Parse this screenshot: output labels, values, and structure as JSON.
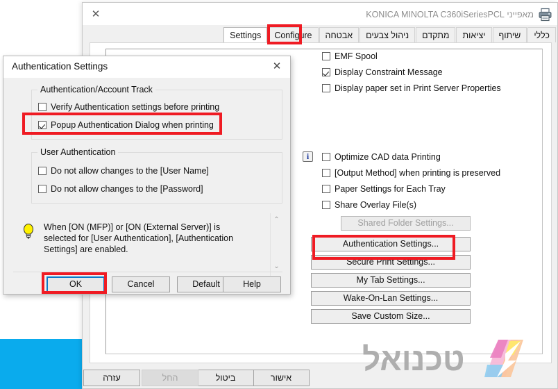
{
  "window": {
    "title": "מאפייני KONICA MINOLTA C360iSeriesPCL",
    "close_label": "✕",
    "printer_icon": "printer-icon",
    "faint_top_text": "מאפיינים"
  },
  "tabs": [
    {
      "label": "כללי",
      "selected": false,
      "ltr": false
    },
    {
      "label": "שיתוף",
      "selected": false,
      "ltr": false
    },
    {
      "label": "יציאות",
      "selected": false,
      "ltr": false
    },
    {
      "label": "מתקדם",
      "selected": false,
      "ltr": false
    },
    {
      "label": "ניהול צבעים",
      "selected": false,
      "ltr": false
    },
    {
      "label": "אבטחה",
      "selected": false,
      "ltr": false
    },
    {
      "label": "Configure",
      "selected": false,
      "ltr": true
    },
    {
      "label": "Settings",
      "selected": true,
      "ltr": true
    }
  ],
  "settings_tab": {
    "checkboxes": [
      {
        "label": "EMF Spool",
        "checked": false
      },
      {
        "label": "Display Constraint Message",
        "checked": true
      },
      {
        "label": "Display paper set in Print Server Properties",
        "checked": false
      },
      {
        "label": "Optimize CAD data Printing",
        "checked": false
      },
      {
        "label": "[Output Method] when printing is preserved",
        "checked": false
      },
      {
        "label": "Paper Settings for Each Tray",
        "checked": false
      },
      {
        "label": "Share Overlay File(s)",
        "checked": false
      }
    ],
    "info_icon": "info-icon",
    "buttons": [
      {
        "label": "Shared Folder Settings...",
        "disabled": true
      },
      {
        "label": "Authentication Settings...",
        "disabled": false
      },
      {
        "label": "Secure Print Settings...",
        "disabled": false
      },
      {
        "label": "My Tab Settings...",
        "disabled": false
      },
      {
        "label": "Wake-On-Lan Settings...",
        "disabled": false
      },
      {
        "label": "Save Custom Size...",
        "disabled": false
      }
    ]
  },
  "main_footer": {
    "buttons": [
      {
        "label": "אישור",
        "disabled": false
      },
      {
        "label": "ביטול",
        "disabled": false
      },
      {
        "label": "החל",
        "disabled": true
      },
      {
        "label": "עזרה",
        "disabled": false
      }
    ]
  },
  "auth_dialog": {
    "title": "Authentication Settings",
    "close_label": "✕",
    "group1": {
      "legend": "Authentication/Account Track",
      "checkboxes": [
        {
          "label": "Verify Authentication settings before printing",
          "checked": false
        },
        {
          "label": "Popup Authentication Dialog when printing",
          "checked": true
        }
      ]
    },
    "group2": {
      "legend": "User Authentication",
      "checkboxes": [
        {
          "label": "Do not allow changes to the [User Name]",
          "checked": false
        },
        {
          "label": "Do not allow changes to the [Password]",
          "checked": false
        }
      ]
    },
    "tip": {
      "icon": "lightbulb-icon",
      "text": "When [ON (MFP)] or [ON (External Server)] is selected for [User Authentication], [Authentication Settings] are enabled.",
      "scroll_up": "⌃",
      "scroll_down": "⌄"
    },
    "buttons": [
      {
        "label": "OK",
        "focused": true
      },
      {
        "label": "Cancel",
        "focused": false
      },
      {
        "label": "Default",
        "focused": false
      },
      {
        "label": "Help",
        "focused": false
      }
    ]
  },
  "annotations": {
    "highlight_color": "#ef1b23",
    "focus_color": "#0a7ac8",
    "boxes": [
      {
        "name": "settings-tab-highlight"
      },
      {
        "name": "popup-auth-checkbox-highlight"
      },
      {
        "name": "ok-button-highlight"
      },
      {
        "name": "authentication-settings-button-highlight"
      }
    ]
  },
  "watermark": {
    "text": "טכנואל",
    "logo": "technoal-logo"
  },
  "desktop": {
    "blue_tile_color": "#0aabed"
  }
}
